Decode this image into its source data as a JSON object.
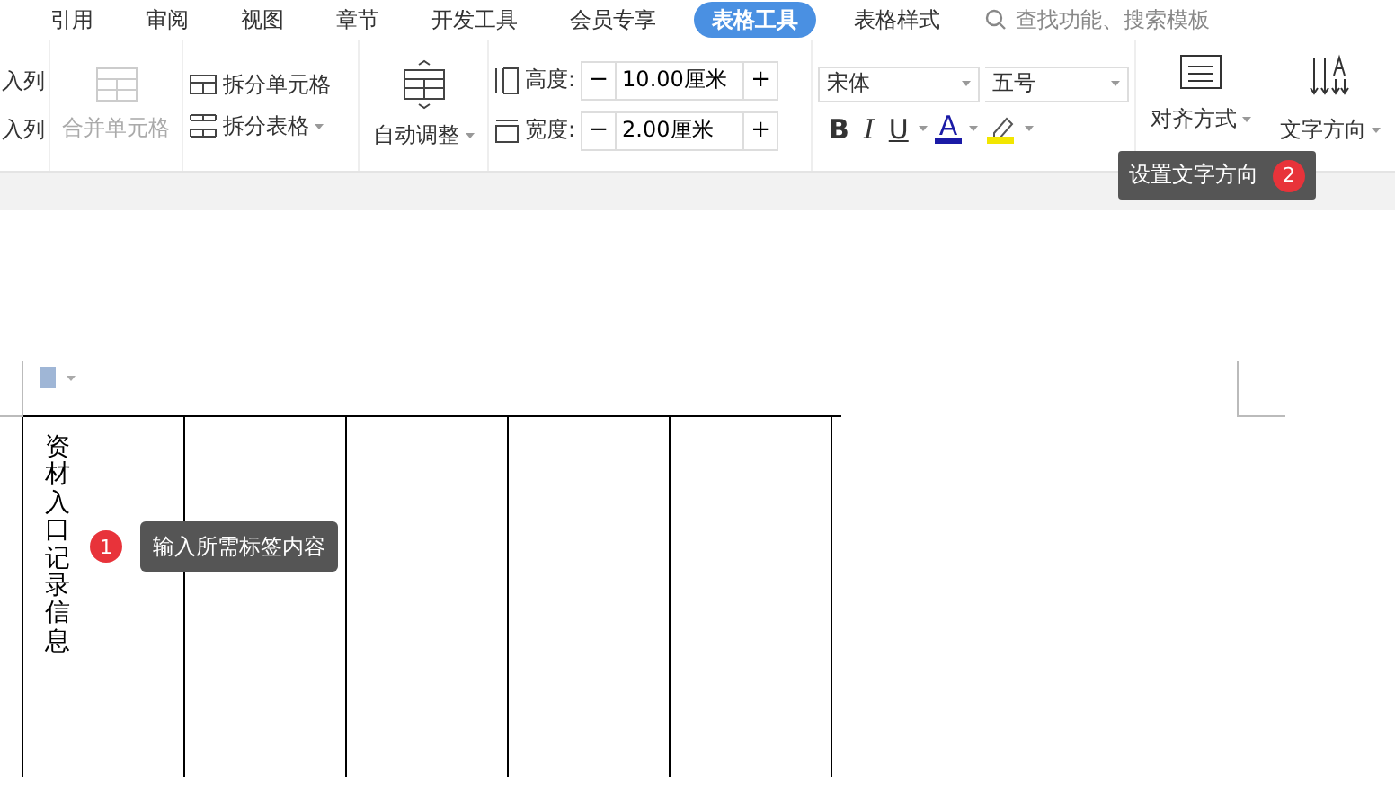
{
  "tabs": [
    {
      "label": "引用",
      "selected": false
    },
    {
      "label": "审阅",
      "selected": false
    },
    {
      "label": "视图",
      "selected": false
    },
    {
      "label": "章节",
      "selected": false
    },
    {
      "label": "开发工具",
      "selected": false
    },
    {
      "label": "会员专享",
      "selected": false
    },
    {
      "label": "表格工具",
      "selected": true
    },
    {
      "label": "表格样式",
      "selected": false
    }
  ],
  "search": {
    "placeholder": "查找功能、搜索模板"
  },
  "ribbon": {
    "cut_items": [
      "入列",
      "入列"
    ],
    "merge": {
      "label": "合并单元格",
      "disabled": true
    },
    "split": [
      {
        "label": "拆分单元格",
        "dropdown": false
      },
      {
        "label": "拆分表格",
        "dropdown": true
      }
    ],
    "autofit": {
      "label": "自动调整"
    },
    "size_fields": [
      {
        "kind": "height",
        "label": "高度:",
        "value": "10.00厘米",
        "minus": "−",
        "plus": "+"
      },
      {
        "kind": "width",
        "label": "宽度:",
        "value": "2.00厘米",
        "minus": "−",
        "plus": "+"
      }
    ],
    "font": {
      "family": "宋体",
      "size": "五号"
    },
    "format_buttons": [
      {
        "kind": "bold",
        "label": "B"
      },
      {
        "kind": "italic",
        "label": "I"
      },
      {
        "kind": "underline",
        "label": "U"
      },
      {
        "kind": "font-color",
        "label": "A"
      },
      {
        "kind": "highlight"
      }
    ],
    "align": {
      "label": "对齐方式"
    },
    "direction": {
      "label": "文字方向"
    }
  },
  "tooltips": [
    {
      "kind": "ribbon",
      "number": "2",
      "text": "设置文字方向"
    },
    {
      "kind": "table",
      "number": "1",
      "text": "输入所需标签内容"
    }
  ],
  "table": {
    "cells": [
      {
        "kind": "text",
        "text": "资材入口记录信息"
      },
      {
        "kind": "blank"
      },
      {
        "kind": "blank"
      },
      {
        "kind": "blank"
      },
      {
        "kind": "blank"
      }
    ]
  }
}
